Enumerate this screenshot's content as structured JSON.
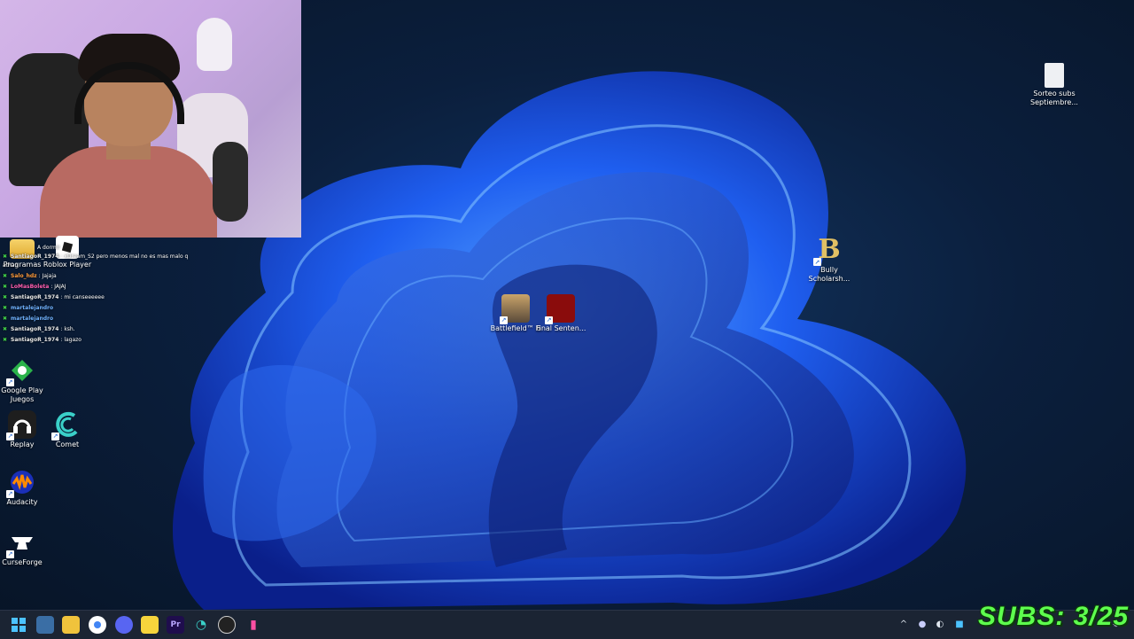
{
  "desktop": {
    "icons": {
      "programas": "Programas",
      "roblox": "Roblox Player",
      "google_play": "Google Play Juegos",
      "replay": "Replay",
      "comet": "Comet",
      "audacity": "Audacity",
      "curseforge": "CurseForge",
      "battlefield": "Battlefield™ 6",
      "final_sentence": "Final Senten...",
      "bully": "Bully Scholarsh...",
      "sorteo": "Sorteo subs Septiembre..."
    }
  },
  "chat": {
    "messages": [
      {
        "user": "",
        "text": "A dormir"
      },
      {
        "user": "SantiagoR_1974",
        "text": ": xDream_S2 pero menos mal no es mas malo q"
      },
      {
        "user": "",
        "text": "athan"
      },
      {
        "user": "Salo_hdz",
        "text": ": Jajaja"
      },
      {
        "user": "LoMasBoleta",
        "text": ": JAJAJ"
      },
      {
        "user": "SantiagoR_1974",
        "text": ": mi canseeeeee"
      },
      {
        "user": "martalejandro",
        "text": ""
      },
      {
        "user": "martalejandro",
        "text": ""
      },
      {
        "user": "SantiagoR_1974",
        "text": ": ksh."
      },
      {
        "user": "SantiagoR_1974",
        "text": ": lagazo"
      }
    ]
  },
  "overlay": {
    "subs_counter": "SUBS: 3/25"
  },
  "colors": {
    "wallpaper_bloom": "#1e4fe0",
    "subs_text": "#5eff4e",
    "taskbar": "#1b2433"
  },
  "taskbar": {
    "icons": [
      "start-icon",
      "widgets-icon",
      "file-explorer-icon",
      "chrome-icon",
      "discord-icon",
      "sticky-notes-icon",
      "premiere-icon",
      "comet-icon",
      "obs-icon",
      "app-icon"
    ],
    "premiere_label": "Pr"
  }
}
